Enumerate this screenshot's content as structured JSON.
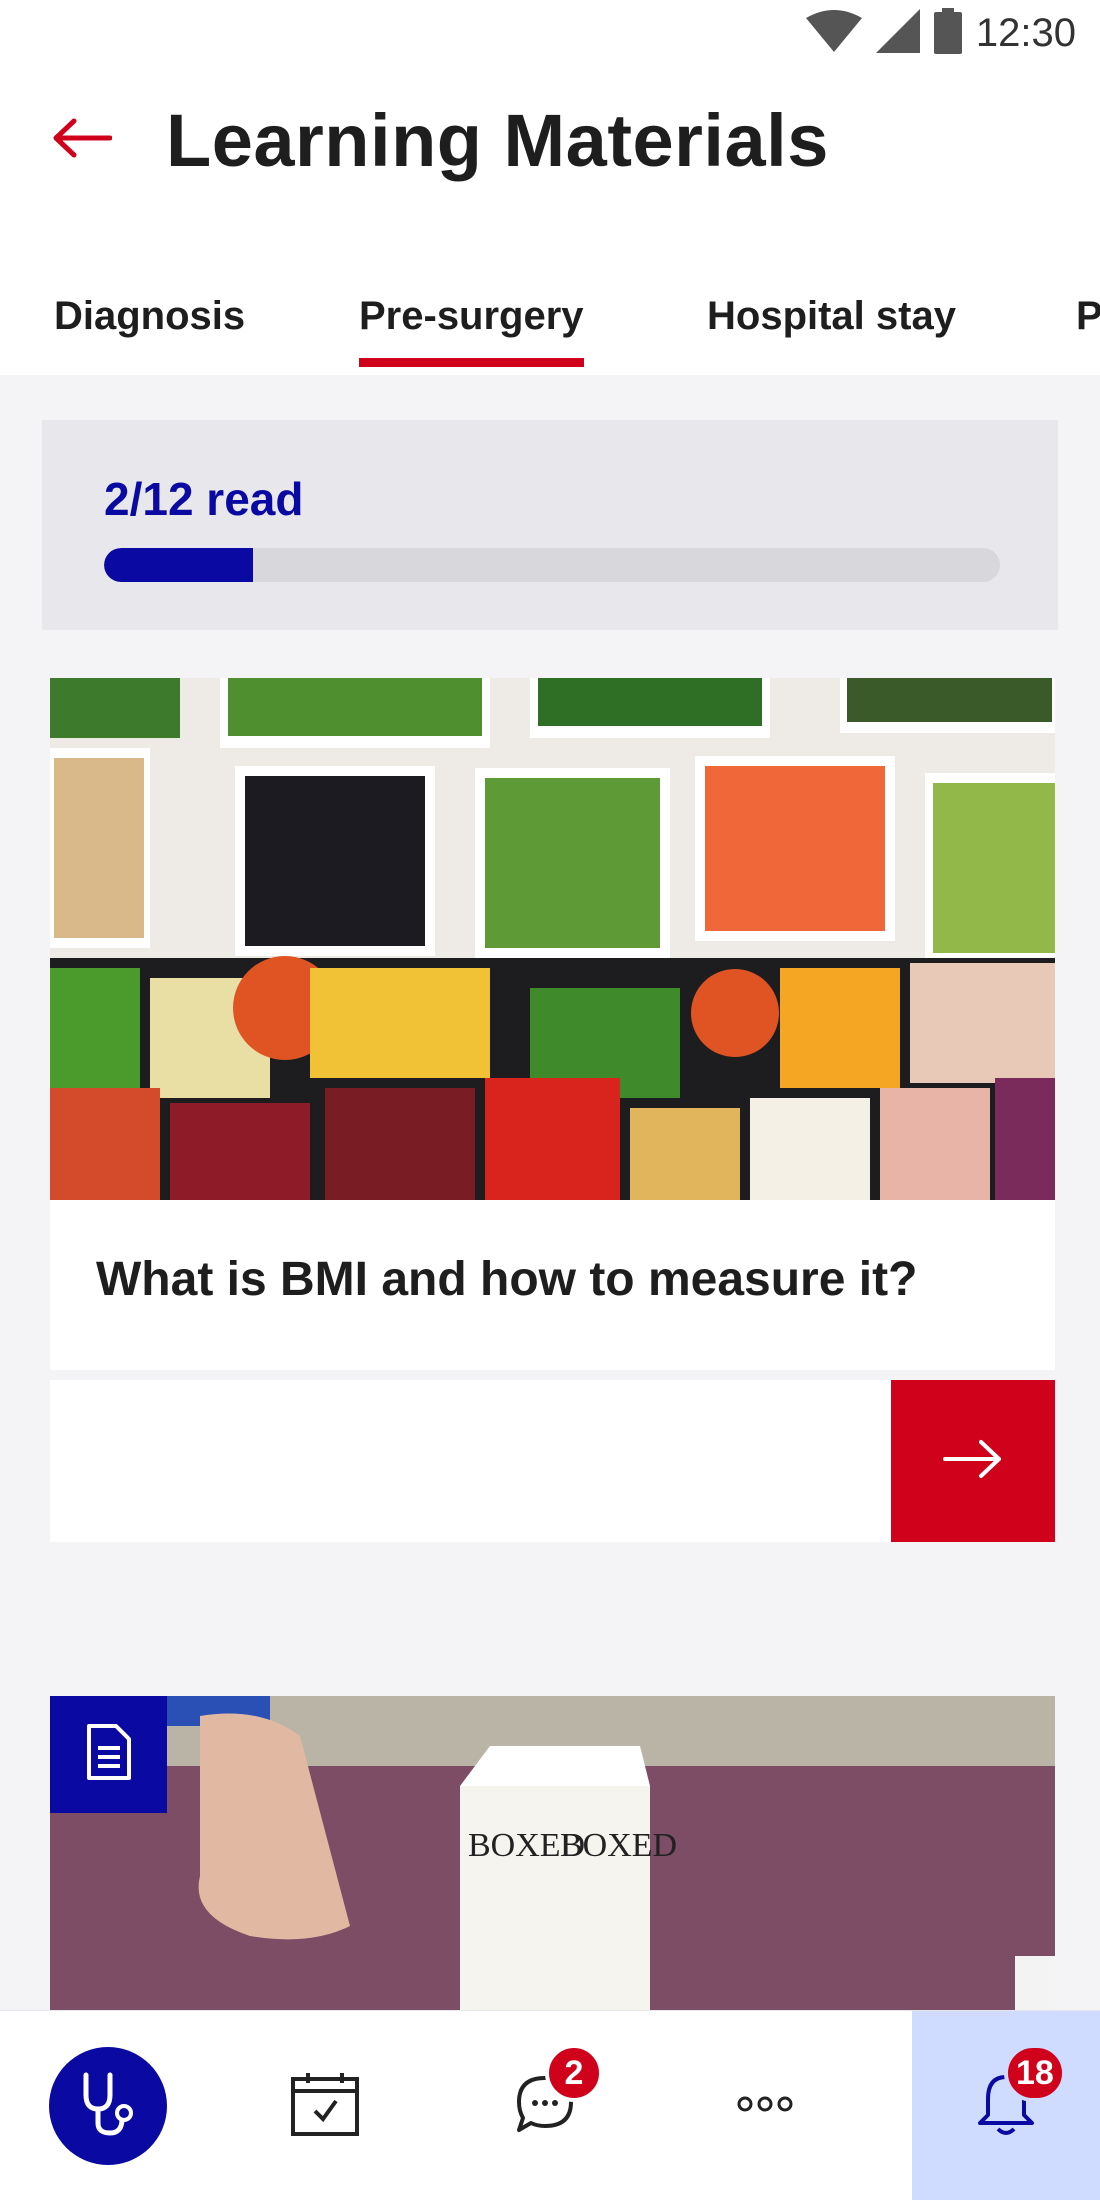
{
  "status_bar": {
    "time": "12:30",
    "icons": [
      "wifi-icon",
      "signal-icon",
      "battery-icon"
    ]
  },
  "header": {
    "title": "Learning Materials",
    "back_icon": "arrow-left-icon"
  },
  "tabs": [
    {
      "label": "Diagnosis",
      "active": false
    },
    {
      "label": "Pre-surgery",
      "active": true
    },
    {
      "label": "Hospital stay",
      "active": false
    },
    {
      "label": "P",
      "active": false
    }
  ],
  "progress": {
    "label": "2/12 read",
    "read": 2,
    "total": 12
  },
  "articles": [
    {
      "title": "What is BMI and how to measure it?",
      "image": "salad-bar-vegetables-image",
      "action_icon": "arrow-right-icon"
    },
    {
      "image": "boxed-water-carton-image",
      "badge_icon": "document-icon"
    }
  ],
  "bottom_nav": {
    "items": [
      {
        "name": "doctor",
        "icon": "stethoscope-icon",
        "active": true
      },
      {
        "name": "calendar",
        "icon": "calendar-check-icon"
      },
      {
        "name": "messages",
        "icon": "chat-bubble-icon",
        "badge": "2"
      },
      {
        "name": "more",
        "icon": "more-dots-icon"
      },
      {
        "name": "notifications",
        "icon": "bell-icon",
        "badge": "18",
        "highlighted": true
      }
    ]
  },
  "colors": {
    "accent_red": "#d0021b",
    "primary_blue": "#0a0aa3",
    "background": "#f4f3f6",
    "notify_highlight": "#cfdcff"
  }
}
